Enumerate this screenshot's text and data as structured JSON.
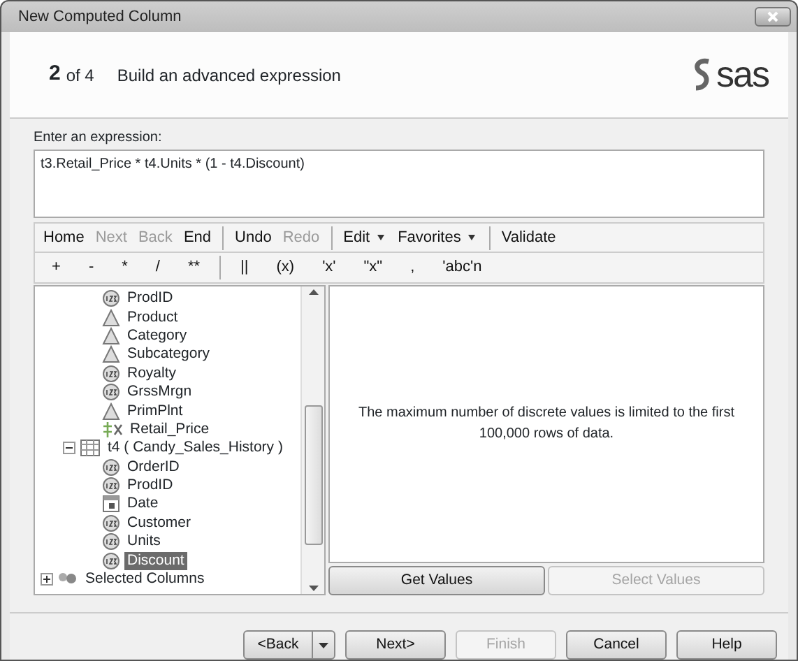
{
  "window": {
    "title": "New Computed Column"
  },
  "header": {
    "step": "2",
    "of": "of 4",
    "title": "Build an advanced expression",
    "logo": "sas"
  },
  "expression": {
    "label": "Enter an expression:",
    "value": "t3.Retail_Price * t4.Units * (1 - t4.Discount)"
  },
  "toolbar": [
    {
      "kind": "button",
      "label": "Home",
      "disabled": false
    },
    {
      "kind": "button",
      "label": "Next",
      "disabled": true
    },
    {
      "kind": "button",
      "label": "Back",
      "disabled": true
    },
    {
      "kind": "button",
      "label": "End",
      "disabled": false
    },
    {
      "kind": "separator"
    },
    {
      "kind": "button",
      "label": "Undo",
      "disabled": false
    },
    {
      "kind": "button",
      "label": "Redo",
      "disabled": true
    },
    {
      "kind": "separator"
    },
    {
      "kind": "menu",
      "label": "Edit",
      "disabled": false
    },
    {
      "kind": "menu",
      "label": "Favorites",
      "disabled": false
    },
    {
      "kind": "separator"
    },
    {
      "kind": "button",
      "label": "Validate",
      "disabled": false
    }
  ],
  "operators": [
    {
      "kind": "button",
      "label": "+"
    },
    {
      "kind": "button",
      "label": "-"
    },
    {
      "kind": "button",
      "label": "*"
    },
    {
      "kind": "button",
      "label": "/"
    },
    {
      "kind": "button",
      "label": "**"
    },
    {
      "kind": "separator"
    },
    {
      "kind": "button",
      "label": "||"
    },
    {
      "kind": "button",
      "label": "(x)"
    },
    {
      "kind": "button",
      "label": "'x'"
    },
    {
      "kind": "button",
      "label": "\"x\""
    },
    {
      "kind": "button",
      "label": ","
    },
    {
      "kind": "button",
      "label": "'abc'n"
    }
  ],
  "tree": {
    "fields_above": [
      {
        "label": "ProdID",
        "kind": "numeric",
        "selected": false
      },
      {
        "label": "Product",
        "kind": "character",
        "selected": false
      },
      {
        "label": "Category",
        "kind": "character",
        "selected": false
      },
      {
        "label": "Subcategory",
        "kind": "character",
        "selected": false
      },
      {
        "label": "Royalty",
        "kind": "numeric",
        "selected": false
      },
      {
        "label": "GrssMrgn",
        "kind": "numeric",
        "selected": false
      },
      {
        "label": "PrimPlnt",
        "kind": "character",
        "selected": false
      },
      {
        "label": "Retail_Price",
        "kind": "computed",
        "selected": false
      }
    ],
    "tables": [
      {
        "label": "t4 ( Candy_Sales_History )",
        "expanded": true,
        "children": [
          {
            "label": "OrderID",
            "kind": "numeric",
            "selected": false
          },
          {
            "label": "ProdID",
            "kind": "numeric",
            "selected": false
          },
          {
            "label": "Date",
            "kind": "date",
            "selected": false
          },
          {
            "label": "Customer",
            "kind": "numeric",
            "selected": false
          },
          {
            "label": "Units",
            "kind": "numeric",
            "selected": false
          },
          {
            "label": "Discount",
            "kind": "numeric",
            "selected": true
          }
        ]
      }
    ],
    "roots": [
      {
        "label": "Selected Columns",
        "expanded": false
      }
    ]
  },
  "values_panel": {
    "message": "The maximum number of discrete values is limited to the first 100,000 rows of data.",
    "buttons": [
      {
        "label": "Get Values",
        "disabled": false
      },
      {
        "label": "Select Values",
        "disabled": true
      }
    ]
  },
  "footer_buttons": [
    {
      "label": "<Back",
      "kind": "split",
      "disabled": false
    },
    {
      "label": "Next>",
      "kind": "plain",
      "disabled": false
    },
    {
      "label": "Finish",
      "kind": "plain",
      "disabled": true
    },
    {
      "label": "Cancel",
      "kind": "plain",
      "disabled": false
    },
    {
      "label": "Help",
      "kind": "plain",
      "disabled": false
    }
  ]
}
